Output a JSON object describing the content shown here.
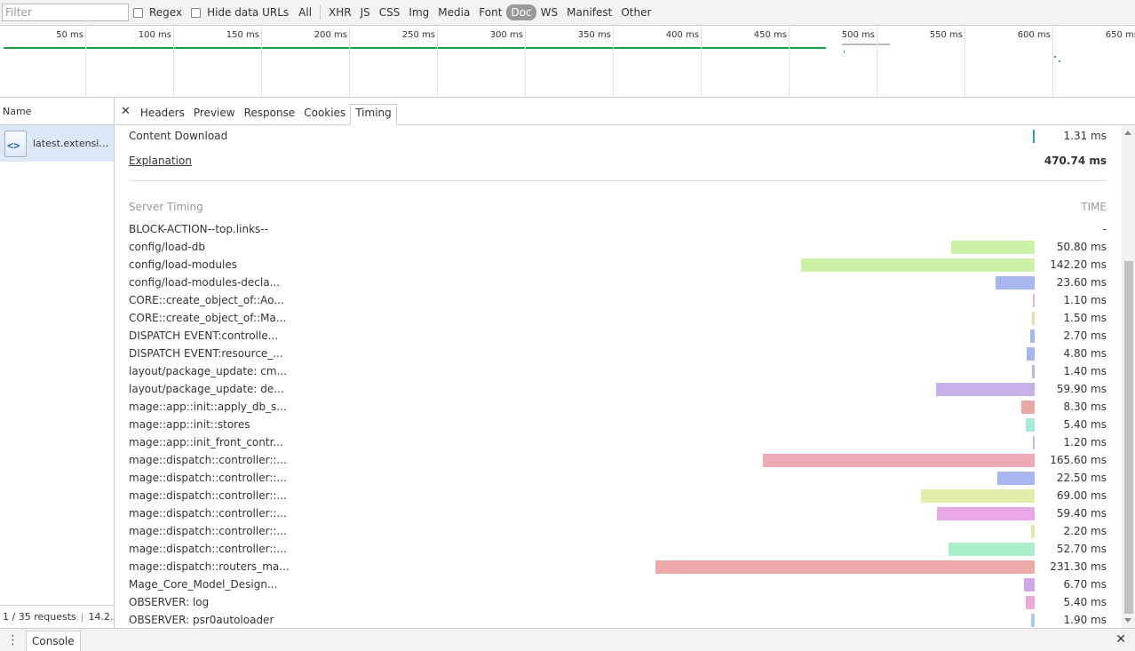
{
  "filterbar": {
    "placeholder": "Filter",
    "regex_label": "Regex",
    "hide_data_label": "Hide data URLs",
    "types": [
      "All",
      "XHR",
      "JS",
      "CSS",
      "Img",
      "Media",
      "Font",
      "Doc",
      "WS",
      "Manifest",
      "Other"
    ],
    "active_type": "Doc"
  },
  "overview": {
    "ticks": [
      "50 ms",
      "100 ms",
      "150 ms",
      "200 ms",
      "250 ms",
      "300 ms",
      "350 ms",
      "400 ms",
      "450 ms",
      "500 ms",
      "550 ms",
      "600 ms",
      "650 ms"
    ]
  },
  "requests": {
    "column_header": "Name",
    "items": [
      {
        "name": "latest.extensions..."
      }
    ],
    "status_count": "1 / 35 requests",
    "status_size": "14.2..."
  },
  "tabs": {
    "items": [
      "Headers",
      "Preview",
      "Response",
      "Cookies",
      "Timing"
    ],
    "active": "Timing"
  },
  "timing": {
    "content_download_label": "Content Download",
    "content_download_value": "1.31 ms",
    "explanation_label": "Explanation",
    "total_value": "470.74 ms",
    "server_timing_header": "Server Timing",
    "time_header": "TIME",
    "server_entries": [
      {
        "label": "BLOCK-ACTION--top.links--",
        "value": "-",
        "ms": 0,
        "color": ""
      },
      {
        "label": "config/load-db",
        "value": "50.80 ms",
        "ms": 50.8,
        "color": "#cdf0a8"
      },
      {
        "label": "config/load-modules",
        "value": "142.20 ms",
        "ms": 142.2,
        "color": "#cdf0a8"
      },
      {
        "label": "config/load-modules-decla...",
        "value": "23.60 ms",
        "ms": 23.6,
        "color": "#a8b6f0"
      },
      {
        "label": "CORE::create_object_of::Ao...",
        "value": "1.10 ms",
        "ms": 1.1,
        "color": "#e8b0e0"
      },
      {
        "label": "CORE::create_object_of::Ma...",
        "value": "1.50 ms",
        "ms": 1.5,
        "color": "#f0dca8"
      },
      {
        "label": "DISPATCH EVENT:controlle...",
        "value": "2.70 ms",
        "ms": 2.7,
        "color": "#a8b6f0"
      },
      {
        "label": "DISPATCH EVENT:resource_...",
        "value": "4.80 ms",
        "ms": 4.8,
        "color": "#a8b6f0"
      },
      {
        "label": "layout/package_update: cm...",
        "value": "1.40 ms",
        "ms": 1.4,
        "color": "#b8b8d8"
      },
      {
        "label": "layout/package_update: de...",
        "value": "59.90 ms",
        "ms": 59.9,
        "color": "#c8b0e8"
      },
      {
        "label": "mage::app::init::apply_db_s...",
        "value": "8.30 ms",
        "ms": 8.3,
        "color": "#e8a8a8"
      },
      {
        "label": "mage::app::init::stores",
        "value": "5.40 ms",
        "ms": 5.4,
        "color": "#a8e8d8"
      },
      {
        "label": "mage::app::init_front_contr...",
        "value": "1.20 ms",
        "ms": 1.2,
        "color": "#c8b0e8"
      },
      {
        "label": "mage::dispatch::controller::...",
        "value": "165.60 ms",
        "ms": 165.6,
        "color": "#eeaab4"
      },
      {
        "label": "mage::dispatch::controller::...",
        "value": "22.50 ms",
        "ms": 22.5,
        "color": "#a8b6f0"
      },
      {
        "label": "mage::dispatch::controller::...",
        "value": "69.00 ms",
        "ms": 69.0,
        "color": "#e0eeaa"
      },
      {
        "label": "mage::dispatch::controller::...",
        "value": "59.40 ms",
        "ms": 59.4,
        "color": "#e8a8e8"
      },
      {
        "label": "mage::dispatch::controller::...",
        "value": "2.20 ms",
        "ms": 2.2,
        "color": "#e8e8a8"
      },
      {
        "label": "mage::dispatch::controller::...",
        "value": "52.70 ms",
        "ms": 52.7,
        "color": "#a8eec8"
      },
      {
        "label": "mage::dispatch::routers_ma...",
        "value": "231.30 ms",
        "ms": 231.3,
        "color": "#eeaaaa"
      },
      {
        "label": "Mage_Core_Model_Design...",
        "value": "6.70 ms",
        "ms": 6.7,
        "color": "#d0a8e8"
      },
      {
        "label": "OBSERVER: log",
        "value": "5.40 ms",
        "ms": 5.4,
        "color": "#eea8d8"
      },
      {
        "label": "OBSERVER: psr0autoloader",
        "value": "1.90 ms",
        "ms": 1.9,
        "color": "#a8c8e8"
      }
    ]
  },
  "drawer": {
    "console_label": "Console"
  },
  "colors": {
    "accent_green": "#20a040",
    "download_bar": "#2a9cc8",
    "link": "#1155cc"
  }
}
